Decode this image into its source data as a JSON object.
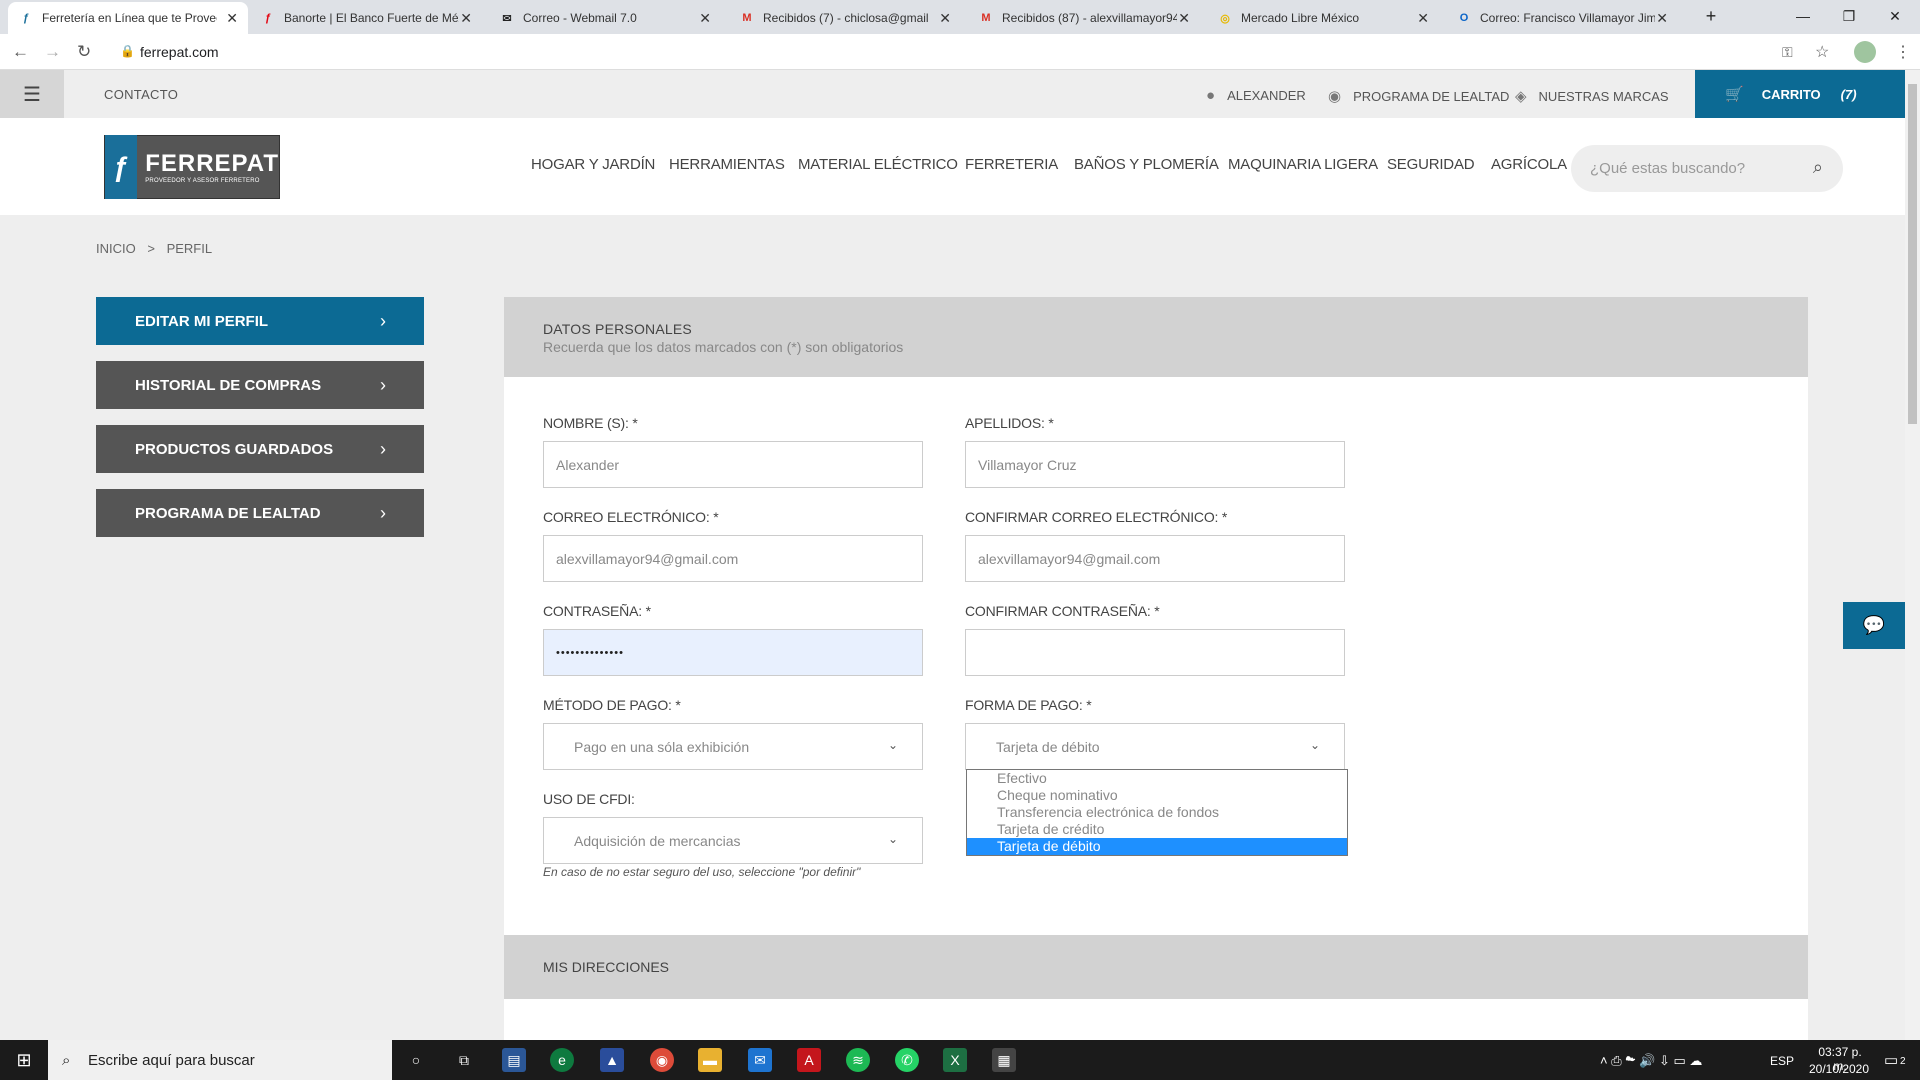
{
  "browser": {
    "tabs": [
      {
        "title": "Ferretería en Línea que te Provee",
        "fav": "ƒ",
        "favcolor": "#1a6f9a"
      },
      {
        "title": "Banorte | El Banco Fuerte de Méx",
        "fav": "ƒ",
        "favcolor": "#e30613"
      },
      {
        "title": "Correo - Webmail 7.0",
        "fav": "✉",
        "favcolor": "#222"
      },
      {
        "title": "Recibidos (7) - chiclosa@gmail",
        "fav": "M",
        "favcolor": "#d93025"
      },
      {
        "title": "Recibidos (87) - alexvillamayor94",
        "fav": "M",
        "favcolor": "#d93025"
      },
      {
        "title": "Mercado Libre México",
        "fav": "◎",
        "favcolor": "#e6b800"
      },
      {
        "title": "Correo: Francisco Villamayor Jim",
        "fav": "O",
        "favcolor": "#0a64c8"
      }
    ],
    "url": "ferrepat.com"
  },
  "topbar": {
    "contacto": "CONTACTO",
    "user": "ALEXANDER",
    "lealtad": "PROGRAMA DE LEALTAD",
    "marcas": "NUESTRAS MARCAS",
    "cart_label": "CARRITO",
    "cart_count": "(7)"
  },
  "logo": {
    "name": "FERREPAT",
    "tagline": "PROVEEDOR Y ASESOR FERRETERO",
    "mark": "ƒ"
  },
  "menu": [
    "HOGAR Y JARDÍN",
    "HERRAMIENTAS",
    "MATERIAL ELÉCTRICO",
    "FERRETERIA",
    "BAÑOS Y PLOMERÍA",
    "MAQUINARIA LIGERA",
    "SEGURIDAD",
    "AGRÍCOLA"
  ],
  "search": {
    "placeholder": "¿Qué estas buscando?"
  },
  "breadcrumb": {
    "home": "INICIO",
    "sep": ">",
    "current": "PERFIL"
  },
  "sidebar": [
    {
      "label": "EDITAR MI PERFIL",
      "active": true
    },
    {
      "label": "HISTORIAL DE COMPRAS",
      "active": false
    },
    {
      "label": "PRODUCTOS GUARDADOS",
      "active": false
    },
    {
      "label": "PROGRAMA DE LEALTAD",
      "active": false
    }
  ],
  "form": {
    "title": "DATOS PERSONALES",
    "subtitle": "Recuerda que los datos marcados con (*) son obligatorios",
    "nombre_label": "NOMBRE (S): *",
    "nombre_value": "Alexander",
    "apellidos_label": "APELLIDOS: *",
    "apellidos_value": "Villamayor Cruz",
    "correo_label": "CORREO ELECTRÓNICO: *",
    "correo_value": "alexvillamayor94@gmail.com",
    "confirmar_correo_label": "CONFIRMAR CORREO ELECTRÓNICO: *",
    "confirmar_correo_value": "alexvillamayor94@gmail.com",
    "password_label": "CONTRASEÑA: *",
    "password_value": "••••••••••••••",
    "confirmar_password_label": "CONFIRMAR CONTRASEÑA: *",
    "confirmar_password_value": "",
    "metodo_label": "MÉTODO DE PAGO: *",
    "metodo_value": "Pago en una sóla exhibición",
    "forma_label": "FORMA DE PAGO: *",
    "forma_value": "Tarjeta de débito",
    "forma_options": [
      "Efectivo",
      "Cheque nominativo",
      "Transferencia electrónica de fondos",
      "Tarjeta de crédito",
      "Tarjeta de débito"
    ],
    "cfdi_label": "USO DE CFDI:",
    "cfdi_value": "Adquisición de mercancias",
    "cfdi_help": "En caso de no estar seguro del uso, seleccione \"por definir\""
  },
  "section2": {
    "title": "MIS DIRECCIONES"
  },
  "taskbar": {
    "search_placeholder": "Escribe aquí para buscar",
    "lang": "ESP",
    "time": "03:37 p. m.",
    "date": "20/10/2020",
    "notifications": "2"
  }
}
